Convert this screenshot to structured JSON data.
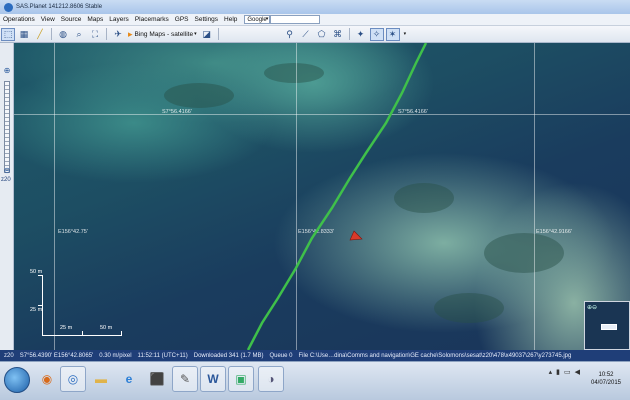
{
  "window": {
    "title": "SAS.Planet 141212.8606 Stable"
  },
  "menu": {
    "items": [
      "Operations",
      "View",
      "Source",
      "Maps",
      "Layers",
      "Placemarks",
      "GPS",
      "Settings",
      "Help"
    ],
    "search_engine": "Google"
  },
  "toolbar": {
    "map_source_label": "Bing Maps - satellite"
  },
  "sidebar": {
    "zoom_level": "z20"
  },
  "map": {
    "grid_labels": {
      "lat_top_left": "S7°56.4166'",
      "lat_top_right": "S7°56.4166'",
      "lon_left": "E156°42.75'",
      "lon_mid": "E156°42.8333'",
      "lon_right": "E156°42.9166'"
    },
    "scale": {
      "v_top": "50 m",
      "v_mid": "25 m",
      "h_left": "25 m",
      "h_right": "50 m"
    }
  },
  "status": {
    "zoom": "z20",
    "coords": "S7°56.4390' E156°42.8065'",
    "resolution": "0.30 m/pixel",
    "time": "11:52:11 (UTC+11)",
    "downloaded": "Downloaded 341 (1.7 MB)",
    "queue": "Queue 0",
    "file": "File C:\\Use…dina\\Comms and navigation\\GE cache\\Solomons\\sesat\\z20\\478\\x49037\\267\\y273745.jpg"
  },
  "taskbar": {
    "clock_time": "10:52",
    "clock_date": "04/07/2015",
    "word_label": "W"
  },
  "colors": {
    "track": "#3fc04a",
    "marker": "#d83a2a",
    "statusbar": "#1f3e78"
  }
}
